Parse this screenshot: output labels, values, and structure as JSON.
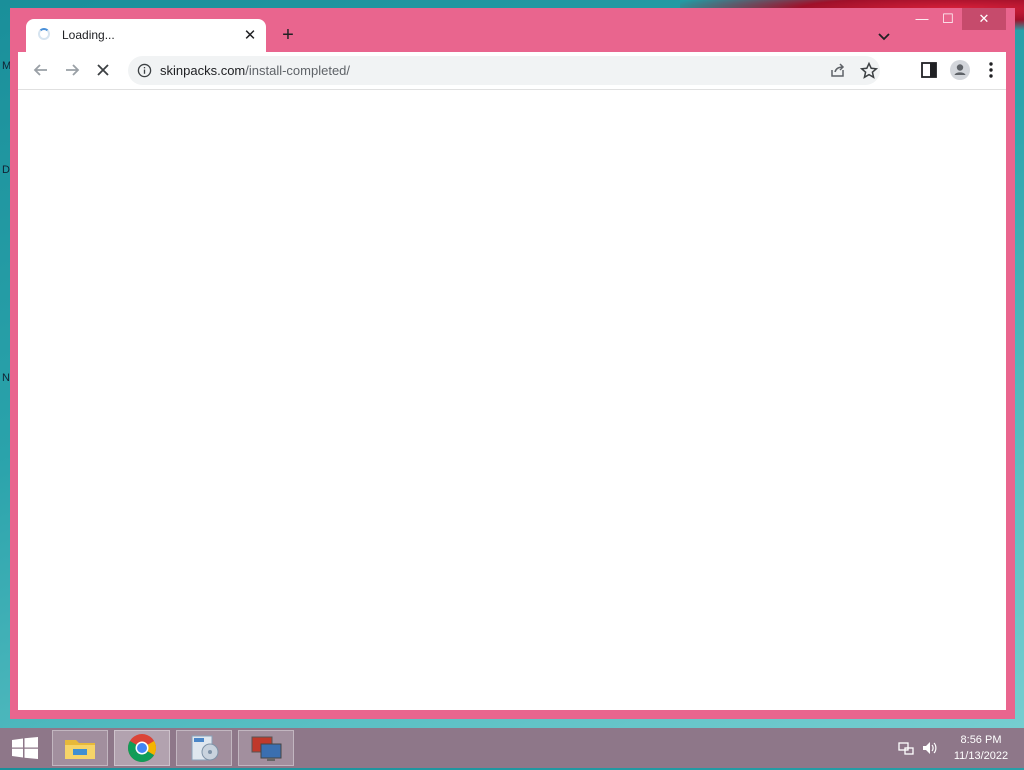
{
  "desktop": {
    "letters": [
      "M",
      "D",
      "N"
    ]
  },
  "browser": {
    "tab": {
      "title": "Loading...",
      "close_label": "✕",
      "state": "loading"
    },
    "new_tab_label": "+",
    "window_controls": {
      "minimize": "—",
      "maximize": "☐",
      "close": "✕"
    },
    "toolbar": {
      "url_domain": "skinpacks.com",
      "url_path": "/install-completed/"
    },
    "colors": {
      "frame": "#e9658e",
      "accent": "#4a90d9"
    }
  },
  "taskbar": {
    "items": [
      "file-explorer",
      "chrome",
      "installer",
      "remote-desktop"
    ],
    "active_item": "chrome",
    "clock": {
      "time": "8:56 PM",
      "date": "11/13/2022"
    }
  }
}
